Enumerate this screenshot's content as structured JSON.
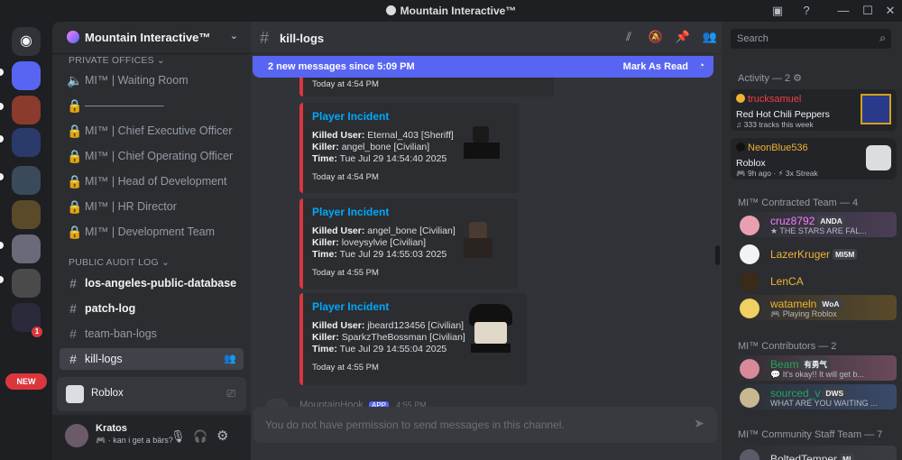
{
  "window": {
    "title": "Mountain Interactive™"
  },
  "rail": {
    "new_badge": "NEW",
    "notif_count": "1"
  },
  "guild": {
    "name": "Mountain Interactive™"
  },
  "categories": {
    "private": "PRIVATE OFFICES",
    "public": "PUBLIC AUDIT LOG"
  },
  "channels_private": [
    "MI™ | Waiting Room",
    "———————",
    "MI™ | Chief Executive Officer",
    "MI™ | Chief Operating Officer",
    "MI™ | Head of Development",
    "MI™ | HR Director",
    "MI™ | Development Team"
  ],
  "channels_public": [
    "los-angeles-public-database",
    "patch-log",
    "team-ban-logs",
    "kill-logs"
  ],
  "activity_card": {
    "label": "Roblox"
  },
  "user": {
    "name": "Kratos",
    "status": "kan i get a bärs?"
  },
  "chat": {
    "channel": "kill-logs",
    "new_messages": "2 new messages since 5:09 PM",
    "mark_read": "Mark As Read",
    "prev_timestamp": "Today at 4:54 PM",
    "composer_placeholder": "You do not have permission to send messages in this channel.",
    "next_author": "MountainHook",
    "next_badge": "APP",
    "next_time": "4:55 PM"
  },
  "embeds": [
    {
      "title": "Player Incident",
      "killed_label": "Killed User:",
      "killed": "Eternal_403 [Sheriff]",
      "killer_label": "Killer:",
      "killer": "angel_bone [Civilian]",
      "time_label": "Time:",
      "time": "Tue Jul 29 14:54:40 2025",
      "footer": "Today at 4:54 PM"
    },
    {
      "title": "Player Incident",
      "killed_label": "Killed User:",
      "killed": "angel_bone [Civilian]",
      "killer_label": "Killer:",
      "killer": "loveysylvie [Civilian]",
      "time_label": "Time:",
      "time": "Tue Jul 29 14:55:03 2025",
      "footer": "Today at 4:55 PM"
    },
    {
      "title": "Player Incident",
      "killed_label": "Killed User:",
      "killed": "jbeard123456 [Civilian]",
      "killer_label": "Killer:",
      "killer": "SparkzTheBossman [Civilian]",
      "time_label": "Time:",
      "time": "Tue Jul 29 14:55:04 2025",
      "footer": "Today at 4:55 PM"
    }
  ],
  "members": {
    "search_placeholder": "Search",
    "activity_header": "Activity — 2",
    "activities": [
      {
        "user": "trucksamuel",
        "title": "Red Hot Chili Peppers",
        "detail": "333 tracks this week"
      },
      {
        "user": "NeonBlue536",
        "title": "Roblox",
        "detail": "9h ago",
        "detail2": "3x Streak"
      }
    ],
    "contracted_header": "MI™ Contracted Team — 4",
    "contracted": [
      {
        "name": "cruz8792",
        "tag": "ANDA",
        "status": "THE STARS ARE FAL..."
      },
      {
        "name": "LazerKruger",
        "tag": "MI5M",
        "status": ""
      },
      {
        "name": "LenCA",
        "tag": "",
        "status": ""
      },
      {
        "name": "watameln",
        "tag": "WoA",
        "status": "Playing Roblox"
      }
    ],
    "contributors_header": "MI™ Contributors — 2",
    "contributors": [
      {
        "name": "Beam",
        "tag": "有勇气",
        "status": "It's okay!! It will get b..."
      },
      {
        "name": "sourced_v",
        "tag": "DWS",
        "status": "WHAT ARE YOU WAITING ..."
      }
    ],
    "staff_header": "MI™ Community Staff Team — 7",
    "staff": [
      {
        "name": "BoltedTemper",
        "tag": "MI"
      }
    ]
  },
  "colors": {
    "accent": "#5865f2",
    "embed_border": "#da373c",
    "link": "#00a8fc"
  }
}
